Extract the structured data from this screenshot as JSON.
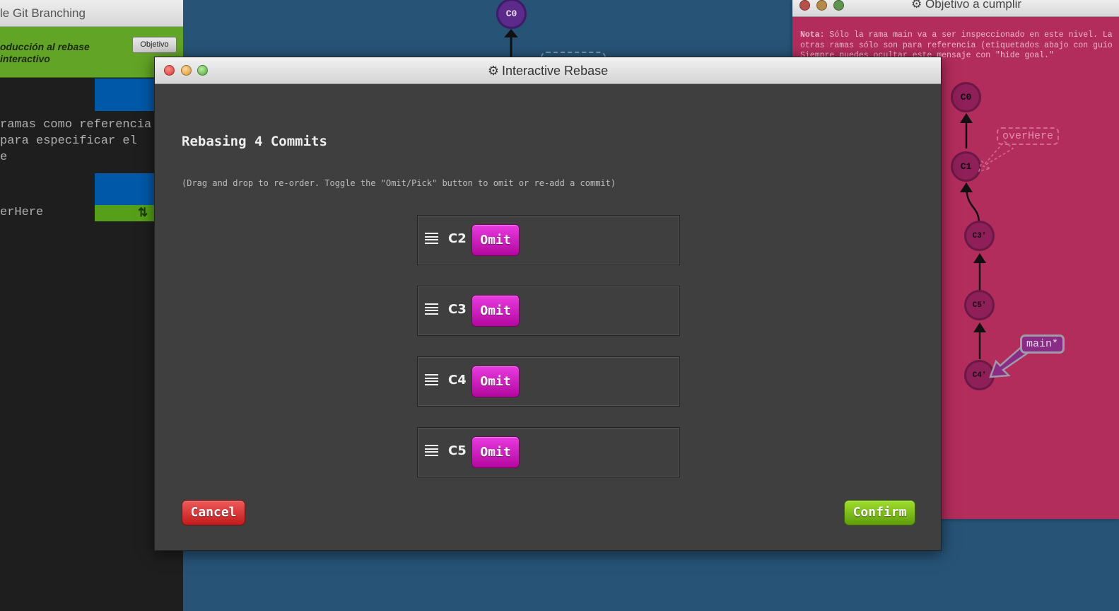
{
  "left_window": {
    "title": "le Git Branching",
    "level_name": "oducción al rebase interactivo",
    "objective_button": "Objetivo",
    "terminal_lines": [
      "ramas como referencia",
      "para especificar el",
      "e"
    ],
    "branch_line": "erHere",
    "swap_icon": "⇅"
  },
  "background_graph": {
    "top_commit": "C0"
  },
  "goal_window": {
    "title": "Objetivo a cumplir",
    "note_label": "Nota:",
    "note_line1": "Sólo la rama main va a ser inspeccionado en este nivel. La",
    "note_line2": "otras ramas sólo son para referencia (etiquetados abajo con guio",
    "note_line3": "Siempre puedes ocultar este mensaje con \"hide goal.\"",
    "commits": [
      "C0",
      "C1",
      "C3'",
      "C5'",
      "C4'"
    ],
    "branches": {
      "overhere": "overHere",
      "main": "main*"
    },
    "accent": "#b32d5c"
  },
  "modal": {
    "title": "Interactive Rebase",
    "gear_icon": "⚙",
    "heading": "Rebasing 4 Commits",
    "help": "(Drag and drop to re-order. Toggle the \"Omit/Pick\" button to omit or re-add a commit)",
    "commits": [
      {
        "name": "C2",
        "toggle": "Omit"
      },
      {
        "name": "C3",
        "toggle": "Omit"
      },
      {
        "name": "C4",
        "toggle": "Omit"
      },
      {
        "name": "C5",
        "toggle": "Omit"
      }
    ],
    "cancel": "Cancel",
    "confirm": "Confirm",
    "colors": {
      "omit": "#d21ec4",
      "cancel": "#d83030",
      "confirm": "#7fbf1a",
      "panel": "#3f3f3f"
    }
  }
}
